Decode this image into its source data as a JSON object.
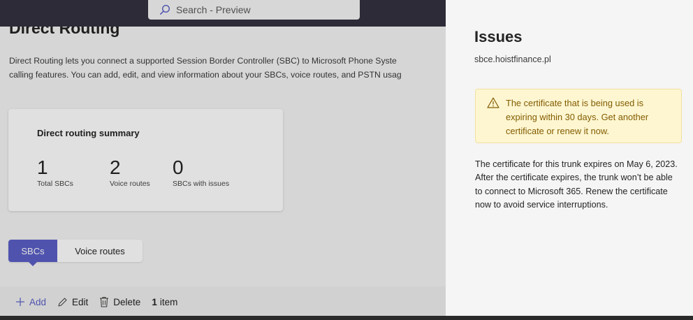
{
  "search": {
    "placeholder": "Search - Preview"
  },
  "page": {
    "title": "Direct Routing",
    "description_line1": "Direct Routing lets you connect a supported Session Border Controller (SBC) to Microsoft Phone Syste",
    "description_line2": "calling features. You can add, edit, and view information about your SBCs, voice routes, and PSTN usag"
  },
  "summary": {
    "title": "Direct routing summary",
    "stats": [
      {
        "value": "1",
        "label": "Total SBCs"
      },
      {
        "value": "2",
        "label": "Voice routes"
      },
      {
        "value": "0",
        "label": "SBCs with issues"
      }
    ]
  },
  "tabs": [
    {
      "label": "SBCs",
      "active": true
    },
    {
      "label": "Voice routes",
      "active": false
    }
  ],
  "toolbar": {
    "add_label": "Add",
    "edit_label": "Edit",
    "delete_label": "Delete",
    "item_count": "1",
    "item_label": "item"
  },
  "panel": {
    "title": "Issues",
    "hostname": "sbce.hoistfinance.pl",
    "warning": "The certificate that is being used is expiring within 30 days. Get another certificate or renew it now.",
    "body": "The certificate for this trunk expires on May 6, 2023. After the certificate expires, the trunk won’t be able to connect to Microsoft 365. Renew the certificate now to avoid service interruptions."
  },
  "colors": {
    "accent": "#5b5fc7",
    "topbar": "#33313f",
    "warning_bg": "#fdf6d1",
    "warning_text": "#835c00"
  },
  "icons": [
    "search-icon",
    "plus-icon",
    "edit-pencil-icon",
    "delete-trash-icon",
    "warning-icon"
  ]
}
